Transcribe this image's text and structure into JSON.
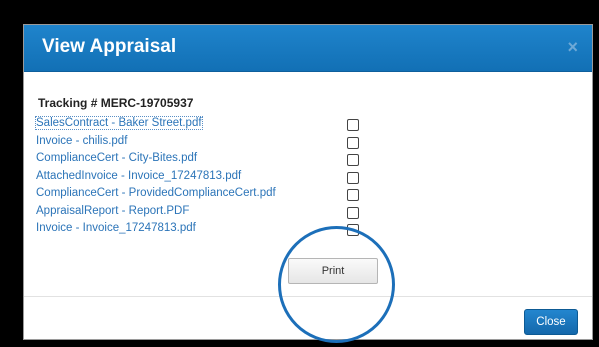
{
  "dialog": {
    "title": "View Appraisal",
    "close_glyph": "×",
    "tracking_label": "Tracking # MERC-19705937"
  },
  "files": [
    {
      "name": "SalesContract - Baker Street.pdf",
      "selected": true,
      "checked": false
    },
    {
      "name": "Invoice - chilis.pdf",
      "checked": false
    },
    {
      "name": "ComplianceCert - City-Bites.pdf",
      "checked": false
    },
    {
      "name": "AttachedInvoice - Invoice_17247813.pdf",
      "checked": false
    },
    {
      "name": "ComplianceCert - ProvidedComplianceCert.pdf",
      "checked": false
    },
    {
      "name": "AppraisalReport - Report.PDF",
      "checked": false
    },
    {
      "name": "Invoice - Invoice_17247813.pdf",
      "checked": false
    }
  ],
  "actions": {
    "print_label": "Print",
    "close_label": "Close"
  },
  "colors": {
    "header": "#1a7cc1",
    "link": "#2b74b8",
    "annotation_circle": "#1c6fb9"
  }
}
